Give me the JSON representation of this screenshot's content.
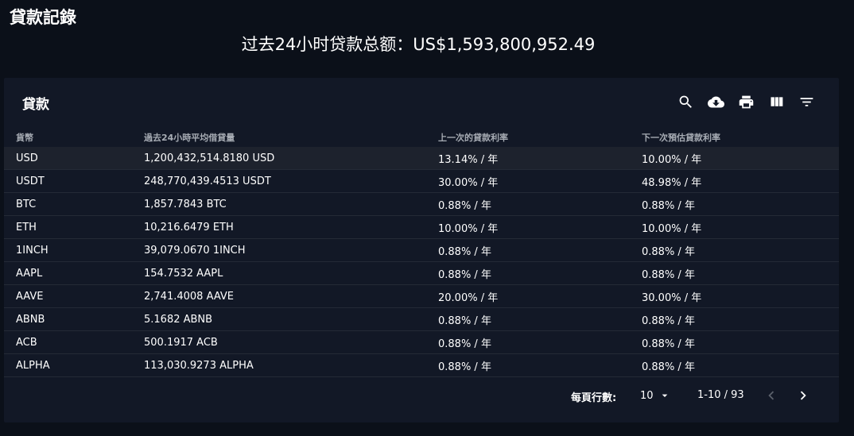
{
  "page": {
    "title": "貸款記錄",
    "total_text": "过去24小时贷款总额：US$1,593,800,952.49"
  },
  "card": {
    "title": "貸款"
  },
  "toolbar": {
    "icons": [
      "search-icon",
      "cloud-download-icon",
      "print-icon",
      "view-column-icon",
      "filter-list-icon"
    ]
  },
  "table": {
    "headers": {
      "currency": "貨幣",
      "avg_volume": "過去24小時平均借貸量",
      "last_rate": "上一次的貸款利率",
      "next_rate": "下一次預估貸款利率"
    },
    "rows": [
      {
        "currency": "USD",
        "avg_volume": "1,200,432,514.8180 USD",
        "last_rate": "13.14% / 年",
        "next_rate": "10.00% / 年"
      },
      {
        "currency": "USDT",
        "avg_volume": "248,770,439.4513 USDT",
        "last_rate": "30.00% / 年",
        "next_rate": "48.98% / 年"
      },
      {
        "currency": "BTC",
        "avg_volume": "1,857.7843 BTC",
        "last_rate": "0.88% / 年",
        "next_rate": "0.88% / 年"
      },
      {
        "currency": "ETH",
        "avg_volume": "10,216.6479 ETH",
        "last_rate": "10.00% / 年",
        "next_rate": "10.00% / 年"
      },
      {
        "currency": "1INCH",
        "avg_volume": "39,079.0670 1INCH",
        "last_rate": "0.88% / 年",
        "next_rate": "0.88% / 年"
      },
      {
        "currency": "AAPL",
        "avg_volume": "154.7532 AAPL",
        "last_rate": "0.88% / 年",
        "next_rate": "0.88% / 年"
      },
      {
        "currency": "AAVE",
        "avg_volume": "2,741.4008 AAVE",
        "last_rate": "20.00% / 年",
        "next_rate": "30.00% / 年"
      },
      {
        "currency": "ABNB",
        "avg_volume": "5.1682 ABNB",
        "last_rate": "0.88% / 年",
        "next_rate": "0.88% / 年"
      },
      {
        "currency": "ACB",
        "avg_volume": "500.1917 ACB",
        "last_rate": "0.88% / 年",
        "next_rate": "0.88% / 年"
      },
      {
        "currency": "ALPHA",
        "avg_volume": "113,030.9273 ALPHA",
        "last_rate": "0.88% / 年",
        "next_rate": "0.88% / 年"
      }
    ]
  },
  "pagination": {
    "rows_per_page_label": "每頁行數:",
    "rows_per_page_value": "10",
    "range_text": "1-10 / 93"
  },
  "colors": {
    "page_bg": "#0b1019",
    "card_bg": "#121826",
    "row_highlight": "#1d222d",
    "header_text": "#a7acb4",
    "text": "#ffffff"
  }
}
